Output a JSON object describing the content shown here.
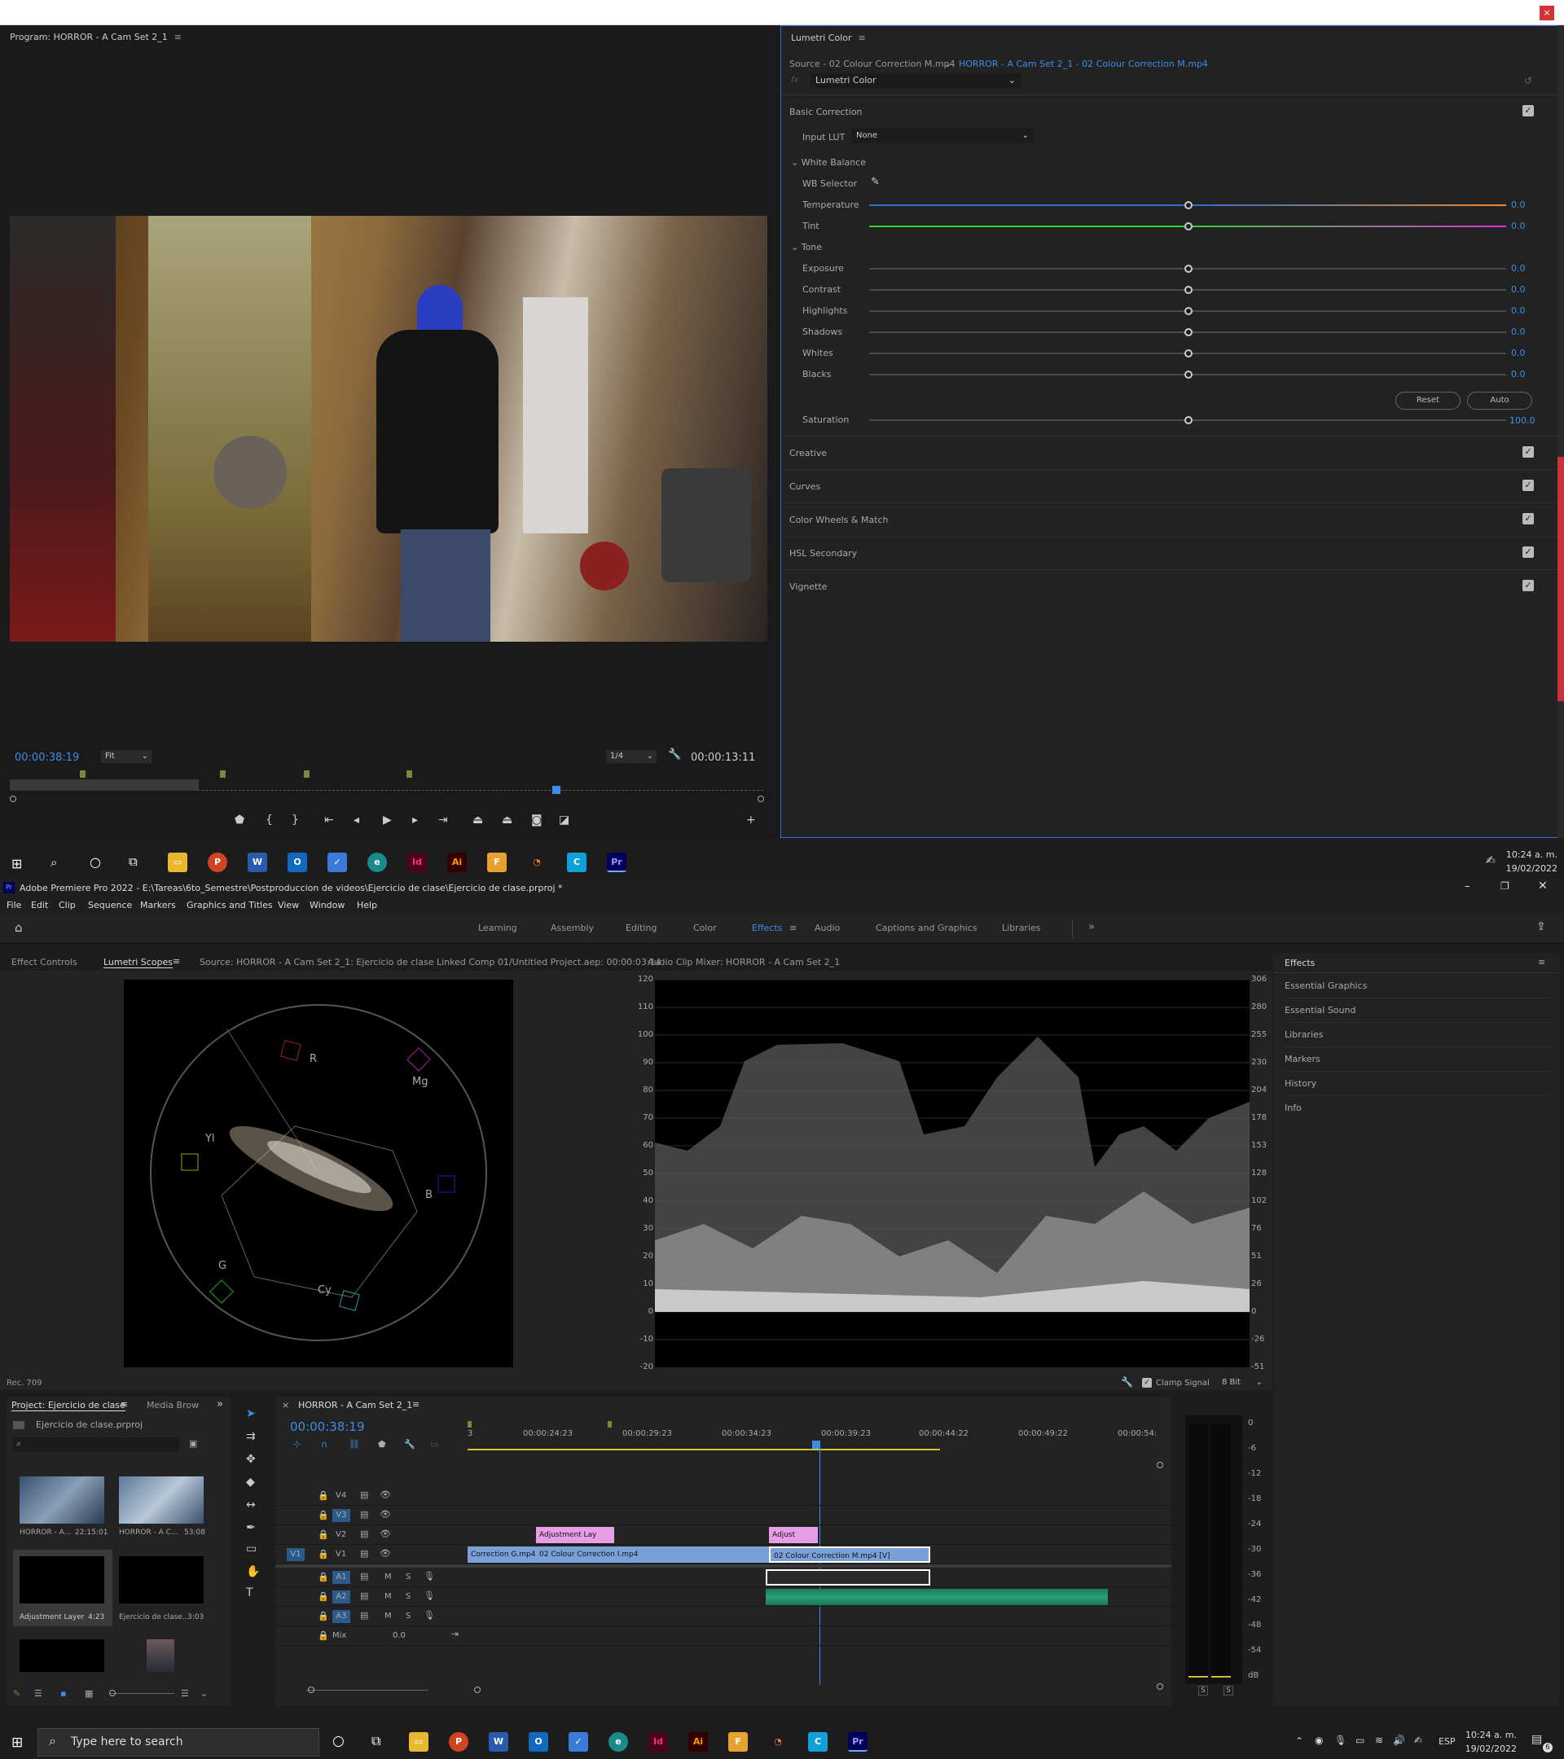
{
  "program_monitor": {
    "title": "Program: HORROR - A Cam Set 2_1",
    "timecode_left": "00:00:38:19",
    "fit": "Fit",
    "resolution": "1/4",
    "timecode_right": "00:00:13:11"
  },
  "lumetri_color": {
    "title": "Lumetri Color",
    "source": "Source - 02 Colour Correction M.mp4",
    "target": "HORROR - A Cam Set 2_1 - 02 Colour Correction M.mp4",
    "effect": "Lumetri Color",
    "basic_correction": "Basic Correction",
    "input_lut_label": "Input LUT",
    "input_lut_value": "None",
    "white_balance": "White Balance",
    "wb_selector": "WB Selector",
    "temperature": "Temperature",
    "temperature_val": "0.0",
    "tint": "Tint",
    "tint_val": "0.0",
    "tone": "Tone",
    "exposure": "Exposure",
    "exposure_val": "0.0",
    "contrast": "Contrast",
    "contrast_val": "0.0",
    "highlights": "Highlights",
    "highlights_val": "0.0",
    "shadows": "Shadows",
    "shadows_val": "0.0",
    "whites": "Whites",
    "whites_val": "0.0",
    "blacks": "Blacks",
    "blacks_val": "0.0",
    "reset": "Reset",
    "auto": "Auto",
    "saturation": "Saturation",
    "saturation_val": "100.0",
    "creative": "Creative",
    "curves": "Curves",
    "color_wheels": "Color Wheels & Match",
    "hsl": "HSL Secondary",
    "vignette": "Vignette"
  },
  "taskbar_top": {
    "time": "10:24 a. m.",
    "date": "19/02/2022"
  },
  "app": {
    "title": "Adobe Premiere Pro 2022 - E:\\Tareas\\6to_Semestre\\Postproduccion de videos\\Ejercicio de clase\\Ejercicio de clase.prproj *",
    "menu": [
      "File",
      "Edit",
      "Clip",
      "Sequence",
      "Markers",
      "Graphics and Titles",
      "View",
      "Window",
      "Help"
    ],
    "workspaces": [
      "Learning",
      "Assembly",
      "Editing",
      "Color",
      "Effects",
      "Audio",
      "Captions and Graphics",
      "Libraries"
    ],
    "active_workspace": "Effects"
  },
  "scopes_panel": {
    "tab_effect_controls": "Effect Controls",
    "tab_lumetri_scopes": "Lumetri Scopes",
    "tab_source": "Source: HORROR - A Cam Set 2_1: Ejercicio de clase Linked Comp 01/Untitled Project.aep: 00:00:03:14",
    "tab_audio_mixer": "Audio Clip Mixer: HORROR - A Cam Set 2_1",
    "rec": "Rec. 709",
    "vector_labels": [
      "R",
      "Mg",
      "B",
      "Cy",
      "G",
      "Yl"
    ],
    "wave_left_ticks": [
      "120",
      "110",
      "100",
      "90",
      "80",
      "70",
      "60",
      "50",
      "40",
      "30",
      "20",
      "10",
      "0",
      "-10",
      "-20"
    ],
    "wave_right_ticks": [
      "306",
      "280",
      "255",
      "230",
      "204",
      "178",
      "153",
      "128",
      "102",
      "76",
      "51",
      "26",
      "0",
      "-26",
      "-51"
    ],
    "clamp_signal": "Clamp Signal",
    "bit_depth": "8 Bit"
  },
  "effects_panel": {
    "title": "Effects",
    "items": [
      "Essential Graphics",
      "Essential Sound",
      "Libraries",
      "Markers",
      "History",
      "Info"
    ]
  },
  "project_panel": {
    "tab_project": "Project: Ejercicio de clase",
    "tab_media": "Media Brow",
    "file": "Ejercicio de clase.prproj",
    "clips": [
      {
        "name": "HORROR - A...",
        "duration": "22:15:01"
      },
      {
        "name": "HORROR - A C...",
        "duration": "53:08"
      },
      {
        "name": "Adjustment Layer",
        "duration": "4:23"
      },
      {
        "name": "Ejercicio de clase...",
        "duration": "3:03"
      }
    ]
  },
  "timeline": {
    "title": "HORROR - A Cam Set 2_1",
    "timecode": "00:00:38:19",
    "ruler": [
      "3",
      "00:00:24:23",
      "00:00:29:23",
      "00:00:34:23",
      "00:00:39:23",
      "00:00:44:22",
      "00:00:49:22",
      "00:00:54:"
    ],
    "tracks_video": [
      "V4",
      "V3",
      "V2",
      "V1"
    ],
    "tracks_audio": [
      "A1",
      "A2",
      "A3"
    ],
    "mix_label": "Mix",
    "mix_value": "0.0",
    "clips": {
      "adj1": "Adjustment Lay",
      "adj2": "Adjust",
      "v1a": "Correction G.mp4",
      "v1b": "02 Colour Correction I.mp4",
      "v1c": "02 Colour Correction M.mp4 [V]"
    },
    "meter_ticks": [
      "0",
      "-6",
      "-12",
      "-18",
      "-24",
      "-30",
      "-36",
      "-42",
      "-48",
      "-54",
      "dB"
    ],
    "solo": [
      "S",
      "S"
    ]
  },
  "taskbar_bottom": {
    "search_placeholder": "Type here to search",
    "lang": "ESP",
    "time": "10:24 a. m.",
    "date": "19/02/2022",
    "notif": "6"
  }
}
